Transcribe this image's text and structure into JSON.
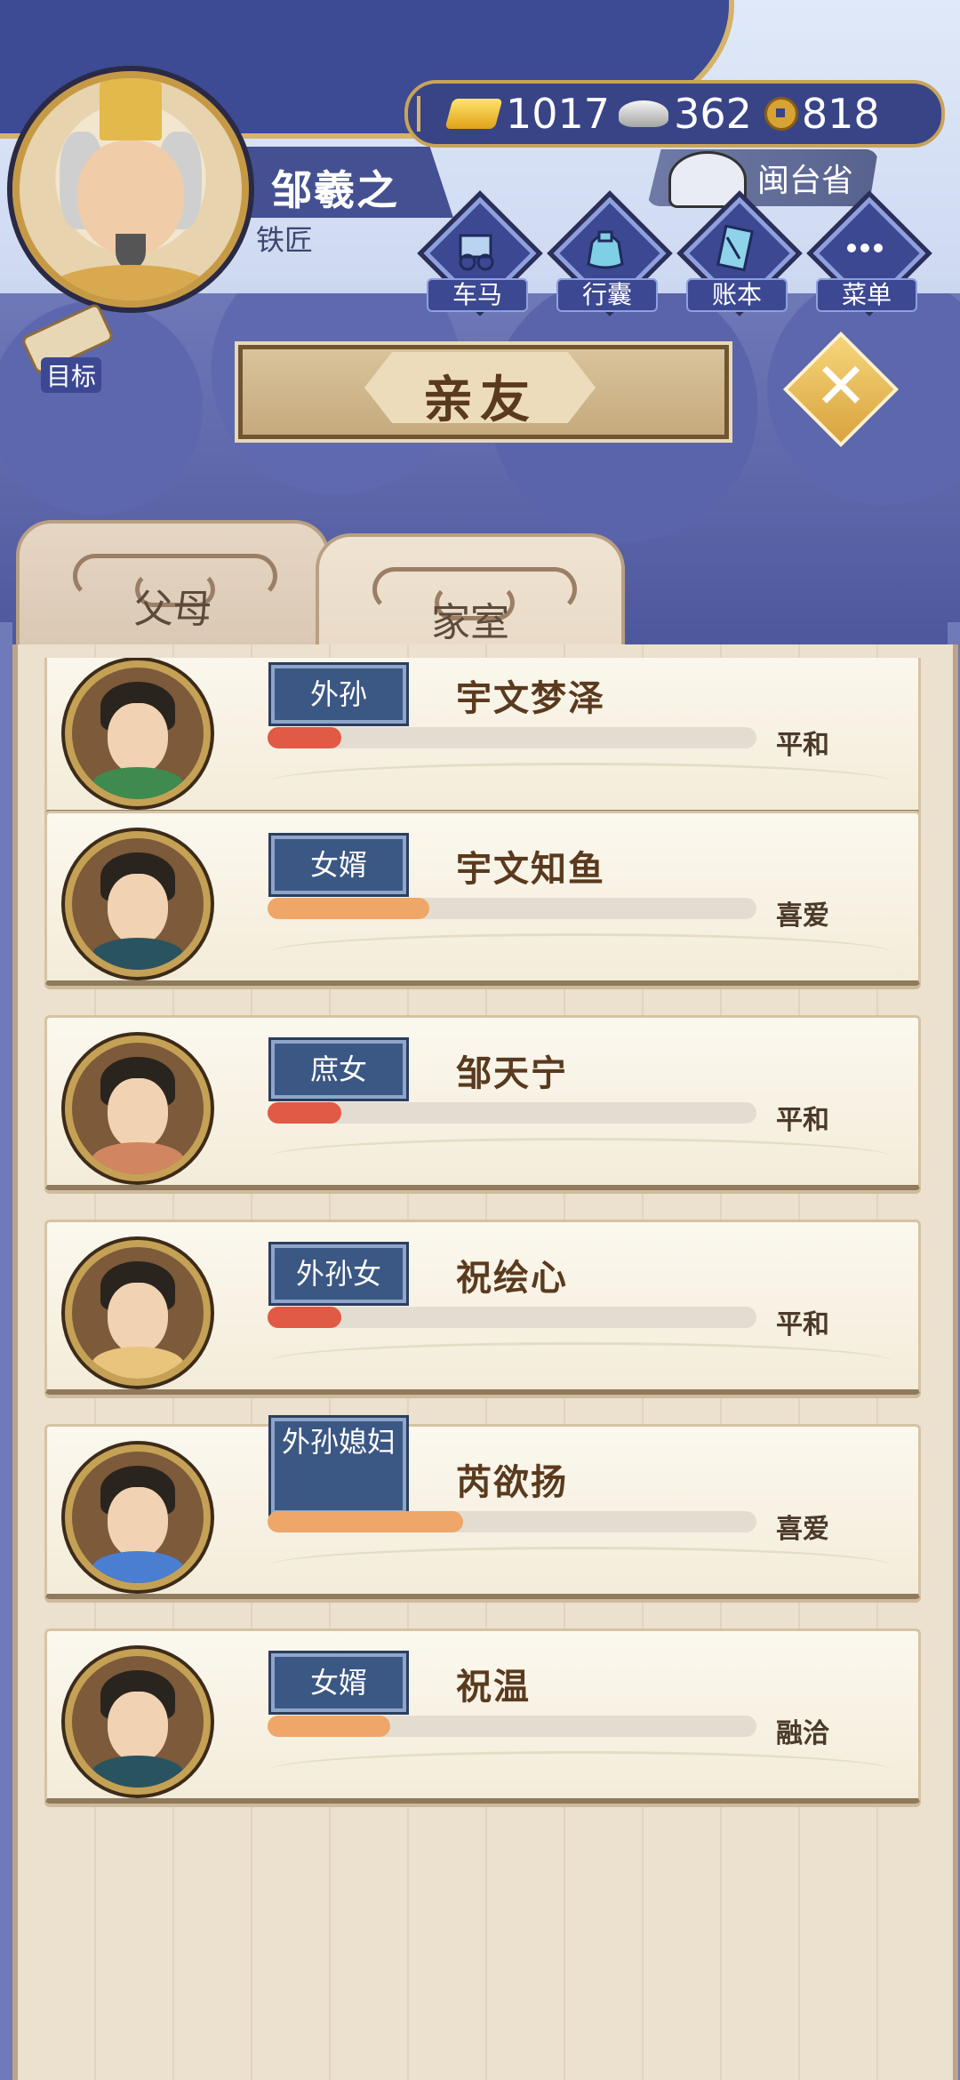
{
  "player": {
    "name": "邹羲之",
    "occupation": "铁匠"
  },
  "currency": {
    "gold": "1017",
    "silver": "362",
    "coins": "818"
  },
  "location": {
    "province": "闽台省"
  },
  "menu": {
    "items": [
      {
        "label": "车马",
        "icon": "carriage-icon"
      },
      {
        "label": "行囊",
        "icon": "bag-icon"
      },
      {
        "label": "账本",
        "icon": "ledger-icon"
      },
      {
        "label": "菜单",
        "icon": "more-icon"
      }
    ],
    "goal_label": "目标"
  },
  "page": {
    "title": "亲友"
  },
  "tabs": [
    {
      "label": "父母",
      "active": false
    },
    {
      "label": "家室",
      "active": true
    }
  ],
  "relatives": [
    {
      "relation": "外孙",
      "name": "宇文梦泽",
      "mood": "平和",
      "affinity": 0.15,
      "bar_color": "#e05a45",
      "body_color": "#3f8a4f"
    },
    {
      "relation": "女婿",
      "name": "宇文知鱼",
      "mood": "喜爱",
      "affinity": 0.33,
      "bar_color": "#eea769",
      "body_color": "#2a5360"
    },
    {
      "relation": "庶女",
      "name": "邹天宁",
      "mood": "平和",
      "affinity": 0.15,
      "bar_color": "#e05a45",
      "body_color": "#d28660"
    },
    {
      "relation": "外孙女",
      "name": "祝绘心",
      "mood": "平和",
      "affinity": 0.15,
      "bar_color": "#e05a45",
      "body_color": "#e8c47c"
    },
    {
      "relation": "外孙媳妇",
      "name": "芮欲扬",
      "mood": "喜爱",
      "affinity": 0.4,
      "bar_color": "#eea769",
      "body_color": "#4a7ed1"
    },
    {
      "relation": "女婿",
      "name": "祝温",
      "mood": "融洽",
      "affinity": 0.25,
      "bar_color": "#eea769",
      "body_color": "#2a5360"
    }
  ]
}
